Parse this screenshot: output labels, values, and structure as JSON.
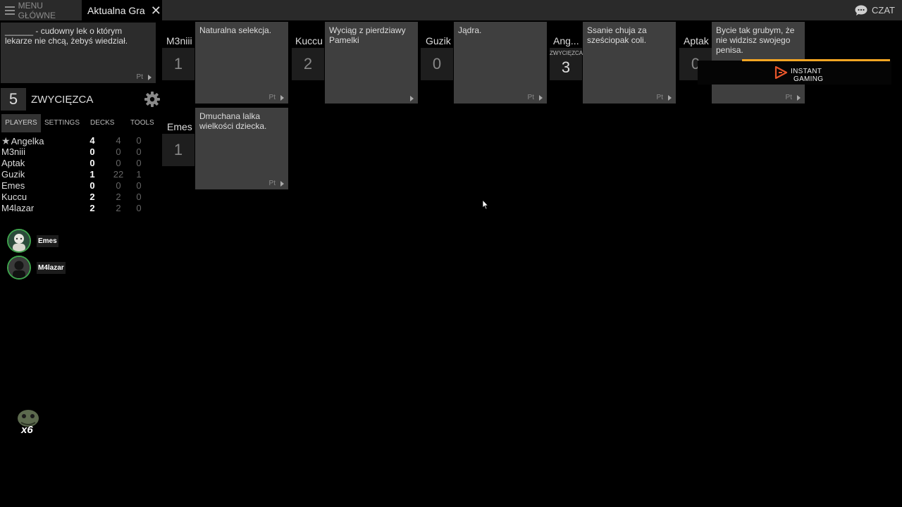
{
  "topbar": {
    "menu_label": "MENU GŁÓWNE",
    "active_tab": "Aktualna Gra",
    "chat_label": "CZAT"
  },
  "black_card": {
    "text": "______ - cudowny lek o którym lekarze nie chcą, żebyś wiedział.",
    "pt": "Pt"
  },
  "goal": {
    "number": "5",
    "label": "ZWYCIĘZCA"
  },
  "sidebar_tabs": [
    "PLAYERS",
    "SETTINGS",
    "DECKS",
    "TOOLS"
  ],
  "players": [
    {
      "name": "Angelka",
      "star": true,
      "score": "4",
      "total": "4",
      "w": "0"
    },
    {
      "name": "M3niii",
      "star": false,
      "score": "0",
      "total": "0",
      "w": "0"
    },
    {
      "name": "Aptak",
      "star": false,
      "score": "0",
      "total": "0",
      "w": "0"
    },
    {
      "name": "Guzik",
      "star": false,
      "score": "1",
      "total": "22",
      "w": "1"
    },
    {
      "name": "Emes",
      "star": false,
      "score": "0",
      "total": "0",
      "w": "0"
    },
    {
      "name": "Kuccu",
      "star": false,
      "score": "2",
      "total": "2",
      "w": "0"
    },
    {
      "name": "M4lazar",
      "star": false,
      "score": "2",
      "total": "2",
      "w": "0"
    }
  ],
  "voice": [
    {
      "name": "Emes"
    },
    {
      "name": "M4lazar"
    }
  ],
  "badge": {
    "label": "x6"
  },
  "submissions": [
    {
      "player": "M3niii",
      "score": "1",
      "winner_label": "",
      "card": "Naturalna selekcja.",
      "pt": "Pt"
    },
    {
      "player": "Kuccu",
      "score": "2",
      "winner_label": "",
      "card": "Wyciąg z pierdziawy Pamelki",
      "pt": ""
    },
    {
      "player": "Guzik",
      "score": "0",
      "winner_label": "",
      "card": "Jądra.",
      "pt": "Pt"
    },
    {
      "player": "Ang...",
      "score": "3",
      "winner_label": "ZWYCIĘZCA",
      "card": "Ssanie chuja za sześciopak coli.",
      "pt": "Pt"
    },
    {
      "player": "Aptak",
      "score": "0",
      "winner_label": "",
      "card": "Bycie tak grubym, że nie widzisz swojego penisa.",
      "pt": "Pt"
    },
    {
      "player": "Emes",
      "score": "1",
      "winner_label": "",
      "card": "Dmuchana lalka wielkości dziecka.",
      "pt": "Pt"
    }
  ],
  "ad": {
    "line1": "INSTANT",
    "line2": "GAMING",
    "accent": "#f5a623"
  }
}
